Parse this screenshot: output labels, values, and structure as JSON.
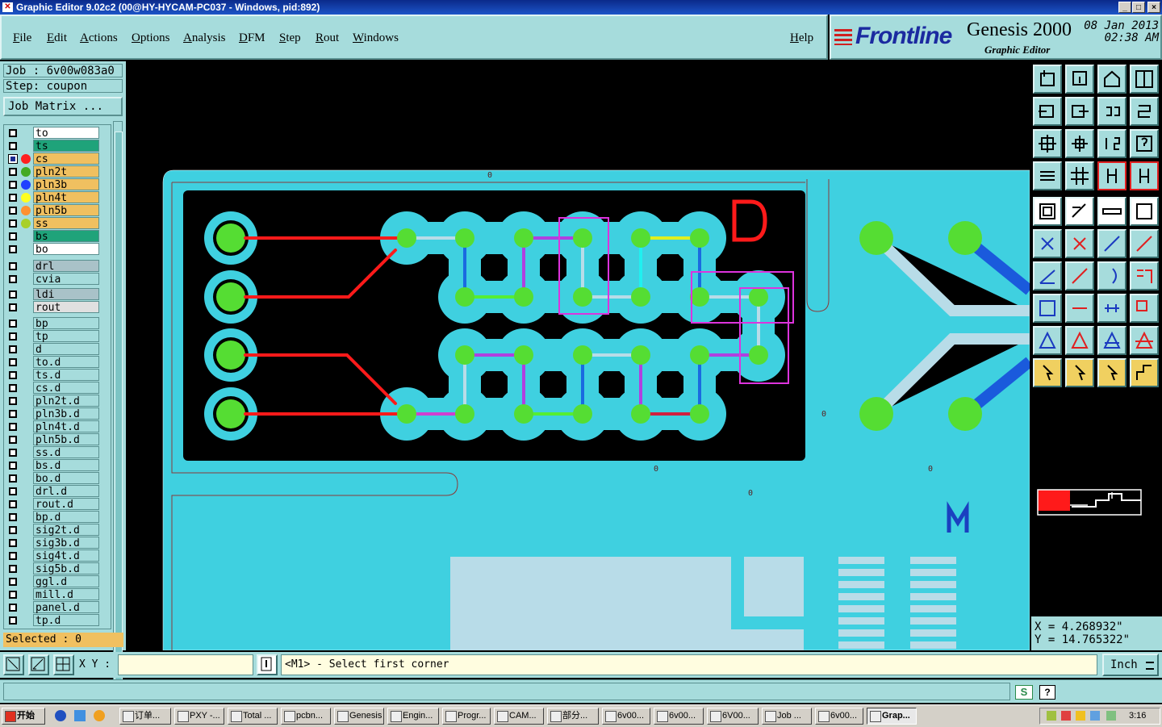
{
  "window": {
    "title": "Graphic Editor 9.02c2 (00@HY-HYCAM-PC037 - Windows, pid:892)",
    "controls": [
      "_",
      "□",
      "×"
    ]
  },
  "menu": [
    "File",
    "Edit",
    "Actions",
    "Options",
    "Analysis",
    "DFM",
    "Step",
    "Rout",
    "Windows"
  ],
  "help_label": "Help",
  "brand": {
    "logo": "Frontline",
    "product": "Genesis 2000",
    "subtitle": "Graphic Editor",
    "date": "08 Jan 2013",
    "time": "02:38 AM"
  },
  "job": {
    "job_text": "Job : 6v00w083a0",
    "step_text": "Step: coupon",
    "matrix_button": "Job Matrix ..."
  },
  "layers": [
    {
      "name": "to",
      "bg": "#ffffff",
      "dot": "",
      "checked": false
    },
    {
      "name": "ts",
      "bg": "#1fa37a",
      "dot": "",
      "checked": false
    },
    {
      "name": "cs",
      "bg": "#f0c060",
      "dot": "#ff2020",
      "checked": true
    },
    {
      "name": "pln2t",
      "bg": "#f0c060",
      "dot": "#44aa22",
      "checked": false
    },
    {
      "name": "pln3b",
      "bg": "#f0c060",
      "dot": "#2040ff",
      "checked": false
    },
    {
      "name": "pln4t",
      "bg": "#f0c060",
      "dot": "#ffff20",
      "checked": false
    },
    {
      "name": "pln5b",
      "bg": "#f0c060",
      "dot": "#ff9030",
      "checked": false
    },
    {
      "name": "ss",
      "bg": "#f0c060",
      "dot": "#a8d028",
      "checked": false
    },
    {
      "name": "bs",
      "bg": "#1fa37a",
      "dot": "",
      "checked": false
    },
    {
      "name": "bo",
      "bg": "#ffffff",
      "dot": "",
      "checked": false
    },
    {
      "name": "drl",
      "bg": "#a9c2c8",
      "dot": "",
      "checked": false
    },
    {
      "name": "cvia",
      "bg": "#a6dcdc",
      "dot": "",
      "checked": false
    },
    {
      "name": "ldi",
      "bg": "#a9c2c8",
      "dot": "",
      "checked": false
    },
    {
      "name": "rout",
      "bg": "#e0e0e0",
      "dot": "",
      "checked": false
    },
    {
      "name": "bp",
      "bg": "#a6dcdc",
      "dot": "",
      "checked": false
    },
    {
      "name": "tp",
      "bg": "#a6dcdc",
      "dot": "",
      "checked": false
    },
    {
      "name": "d",
      "bg": "#a6dcdc",
      "dot": "",
      "checked": false
    },
    {
      "name": "to.d",
      "bg": "#a6dcdc",
      "dot": "",
      "checked": false
    },
    {
      "name": "ts.d",
      "bg": "#a6dcdc",
      "dot": "",
      "checked": false
    },
    {
      "name": "cs.d",
      "bg": "#a6dcdc",
      "dot": "",
      "checked": false
    },
    {
      "name": "pln2t.d",
      "bg": "#a6dcdc",
      "dot": "",
      "checked": false
    },
    {
      "name": "pln3b.d",
      "bg": "#a6dcdc",
      "dot": "",
      "checked": false
    },
    {
      "name": "pln4t.d",
      "bg": "#a6dcdc",
      "dot": "",
      "checked": false
    },
    {
      "name": "pln5b.d",
      "bg": "#a6dcdc",
      "dot": "",
      "checked": false
    },
    {
      "name": "ss.d",
      "bg": "#a6dcdc",
      "dot": "",
      "checked": false
    },
    {
      "name": "bs.d",
      "bg": "#a6dcdc",
      "dot": "",
      "checked": false
    },
    {
      "name": "bo.d",
      "bg": "#a6dcdc",
      "dot": "",
      "checked": false
    },
    {
      "name": "drl.d",
      "bg": "#a6dcdc",
      "dot": "",
      "checked": false
    },
    {
      "name": "rout.d",
      "bg": "#a6dcdc",
      "dot": "",
      "checked": false
    },
    {
      "name": "bp.d",
      "bg": "#a6dcdc",
      "dot": "",
      "checked": false
    },
    {
      "name": "sig2t.d",
      "bg": "#a6dcdc",
      "dot": "",
      "checked": false
    },
    {
      "name": "sig3b.d",
      "bg": "#a6dcdc",
      "dot": "",
      "checked": false
    },
    {
      "name": "sig4t.d",
      "bg": "#a6dcdc",
      "dot": "",
      "checked": false
    },
    {
      "name": "sig5b.d",
      "bg": "#a6dcdc",
      "dot": "",
      "checked": false
    },
    {
      "name": "ggl.d",
      "bg": "#a6dcdc",
      "dot": "",
      "checked": false
    },
    {
      "name": "mill.d",
      "bg": "#a6dcdc",
      "dot": "",
      "checked": false
    },
    {
      "name": "panel.d",
      "bg": "#a6dcdc",
      "dot": "",
      "checked": false
    },
    {
      "name": "tp.d",
      "bg": "#a6dcdc",
      "dot": "",
      "checked": false
    }
  ],
  "selected_text": "Selected : 0",
  "canvas": {
    "marker_d": "D",
    "marker_m": "M",
    "zero_label": "0"
  },
  "coords": {
    "x_text": "X = 4.268932\"",
    "y_text": "Y = 14.765322\""
  },
  "command": {
    "xy_label": "X Y :",
    "xy_value": "",
    "prompt": "<M1> - Select first corner",
    "units": "Inch"
  },
  "taskbar": {
    "start": "开始",
    "clock": "3:16",
    "tasks": [
      "订单...",
      "PXY -...",
      "Total ...",
      "pcbn...",
      "Genesis",
      "Engin...",
      "Progr...",
      "CAM...",
      "部分...",
      "6v00...",
      "6v00...",
      "6V00...",
      "Job ...",
      "6v00...",
      "Grap..."
    ]
  },
  "colors": {
    "panel": "#a6dcdc",
    "board": "#3fd0e0",
    "pad": "#55dd33",
    "trace_red": "#ff1a1a",
    "selection": "#dd33dd"
  }
}
